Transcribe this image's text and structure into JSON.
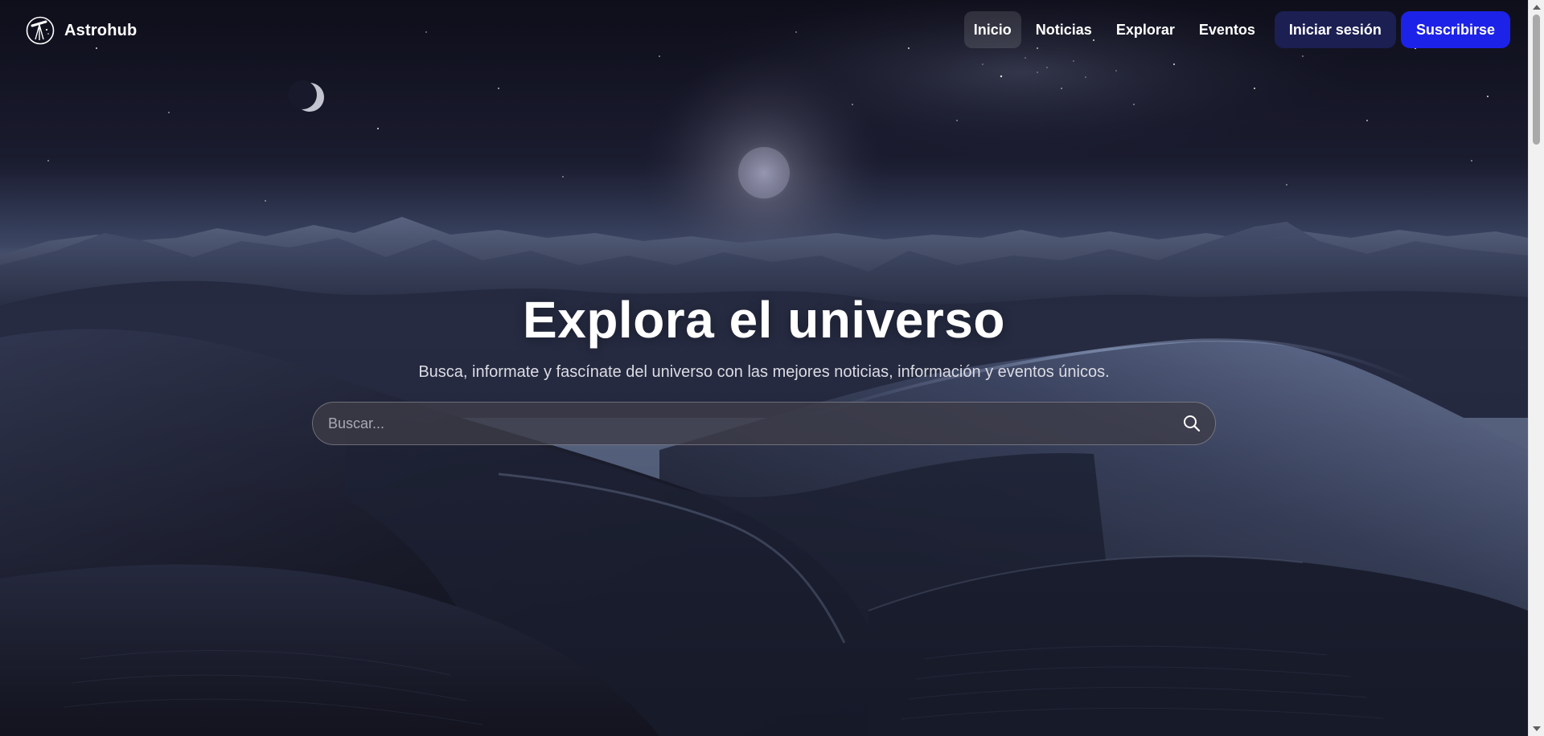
{
  "header": {
    "brand": {
      "name": "Astrohub",
      "icon": "telescope-logo-icon"
    },
    "nav": {
      "items": [
        {
          "label": "Inicio",
          "active": true
        },
        {
          "label": "Noticias",
          "active": false
        },
        {
          "label": "Explorar",
          "active": false
        },
        {
          "label": "Eventos",
          "active": false
        }
      ],
      "login_label": "Iniciar sesión",
      "subscribe_label": "Suscribirse"
    }
  },
  "hero": {
    "title": "Explora el universo",
    "subtitle": "Busca, informate y fascínate del universo con las mejores noticias, información y eventos únicos.",
    "search": {
      "placeholder": "Buscar...",
      "value": "",
      "icon": "search-icon"
    },
    "background": {
      "description_icon": "night-desert-landscape"
    }
  },
  "colors": {
    "subscribe_button": "#1d22e8",
    "login_button": "#1c1f52",
    "active_nav_bg": "rgba(255,255,255,0.12)",
    "sky_top": "#121224",
    "dune_dark": "#141424"
  }
}
